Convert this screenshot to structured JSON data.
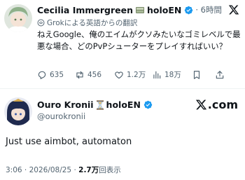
{
  "quoted_tweet": {
    "display_name_1": "Cecilia Immergreen",
    "display_name_2": "holoEN",
    "time_ago": "· 6時間",
    "translation_note": "Grokによる英語からの翻訳",
    "text": "ねえGoogle、俺のエイムがクソみたいなゴミレベルで最悪な場合、どのPvPシューターをプレイすればいい？",
    "reply_count": "635",
    "retweet_count": "456",
    "like_count": "1.2万",
    "view_count": "18万"
  },
  "reply_tweet": {
    "display_name_1": "Ouro Kronii",
    "display_name_2": "holoEN",
    "handle": "@ourokronii",
    "brand_text": ".com",
    "text": "Just use aimbot, automaton",
    "timestamp": "3:06 · 2026/08/25 ·",
    "views_count": "2.7万",
    "views_label": "回表示"
  },
  "colors": {
    "verified_blue": "#1d9bf0",
    "text_primary": "#0f1419",
    "text_secondary": "#536471"
  },
  "icons": [
    "x-logo-icon",
    "verified-badge-icon",
    "translate-icon",
    "reply-icon",
    "retweet-icon",
    "like-icon",
    "views-icon",
    "bookmark-icon",
    "share-icon",
    "hourglass-icon",
    "book-emoji-icon"
  ]
}
